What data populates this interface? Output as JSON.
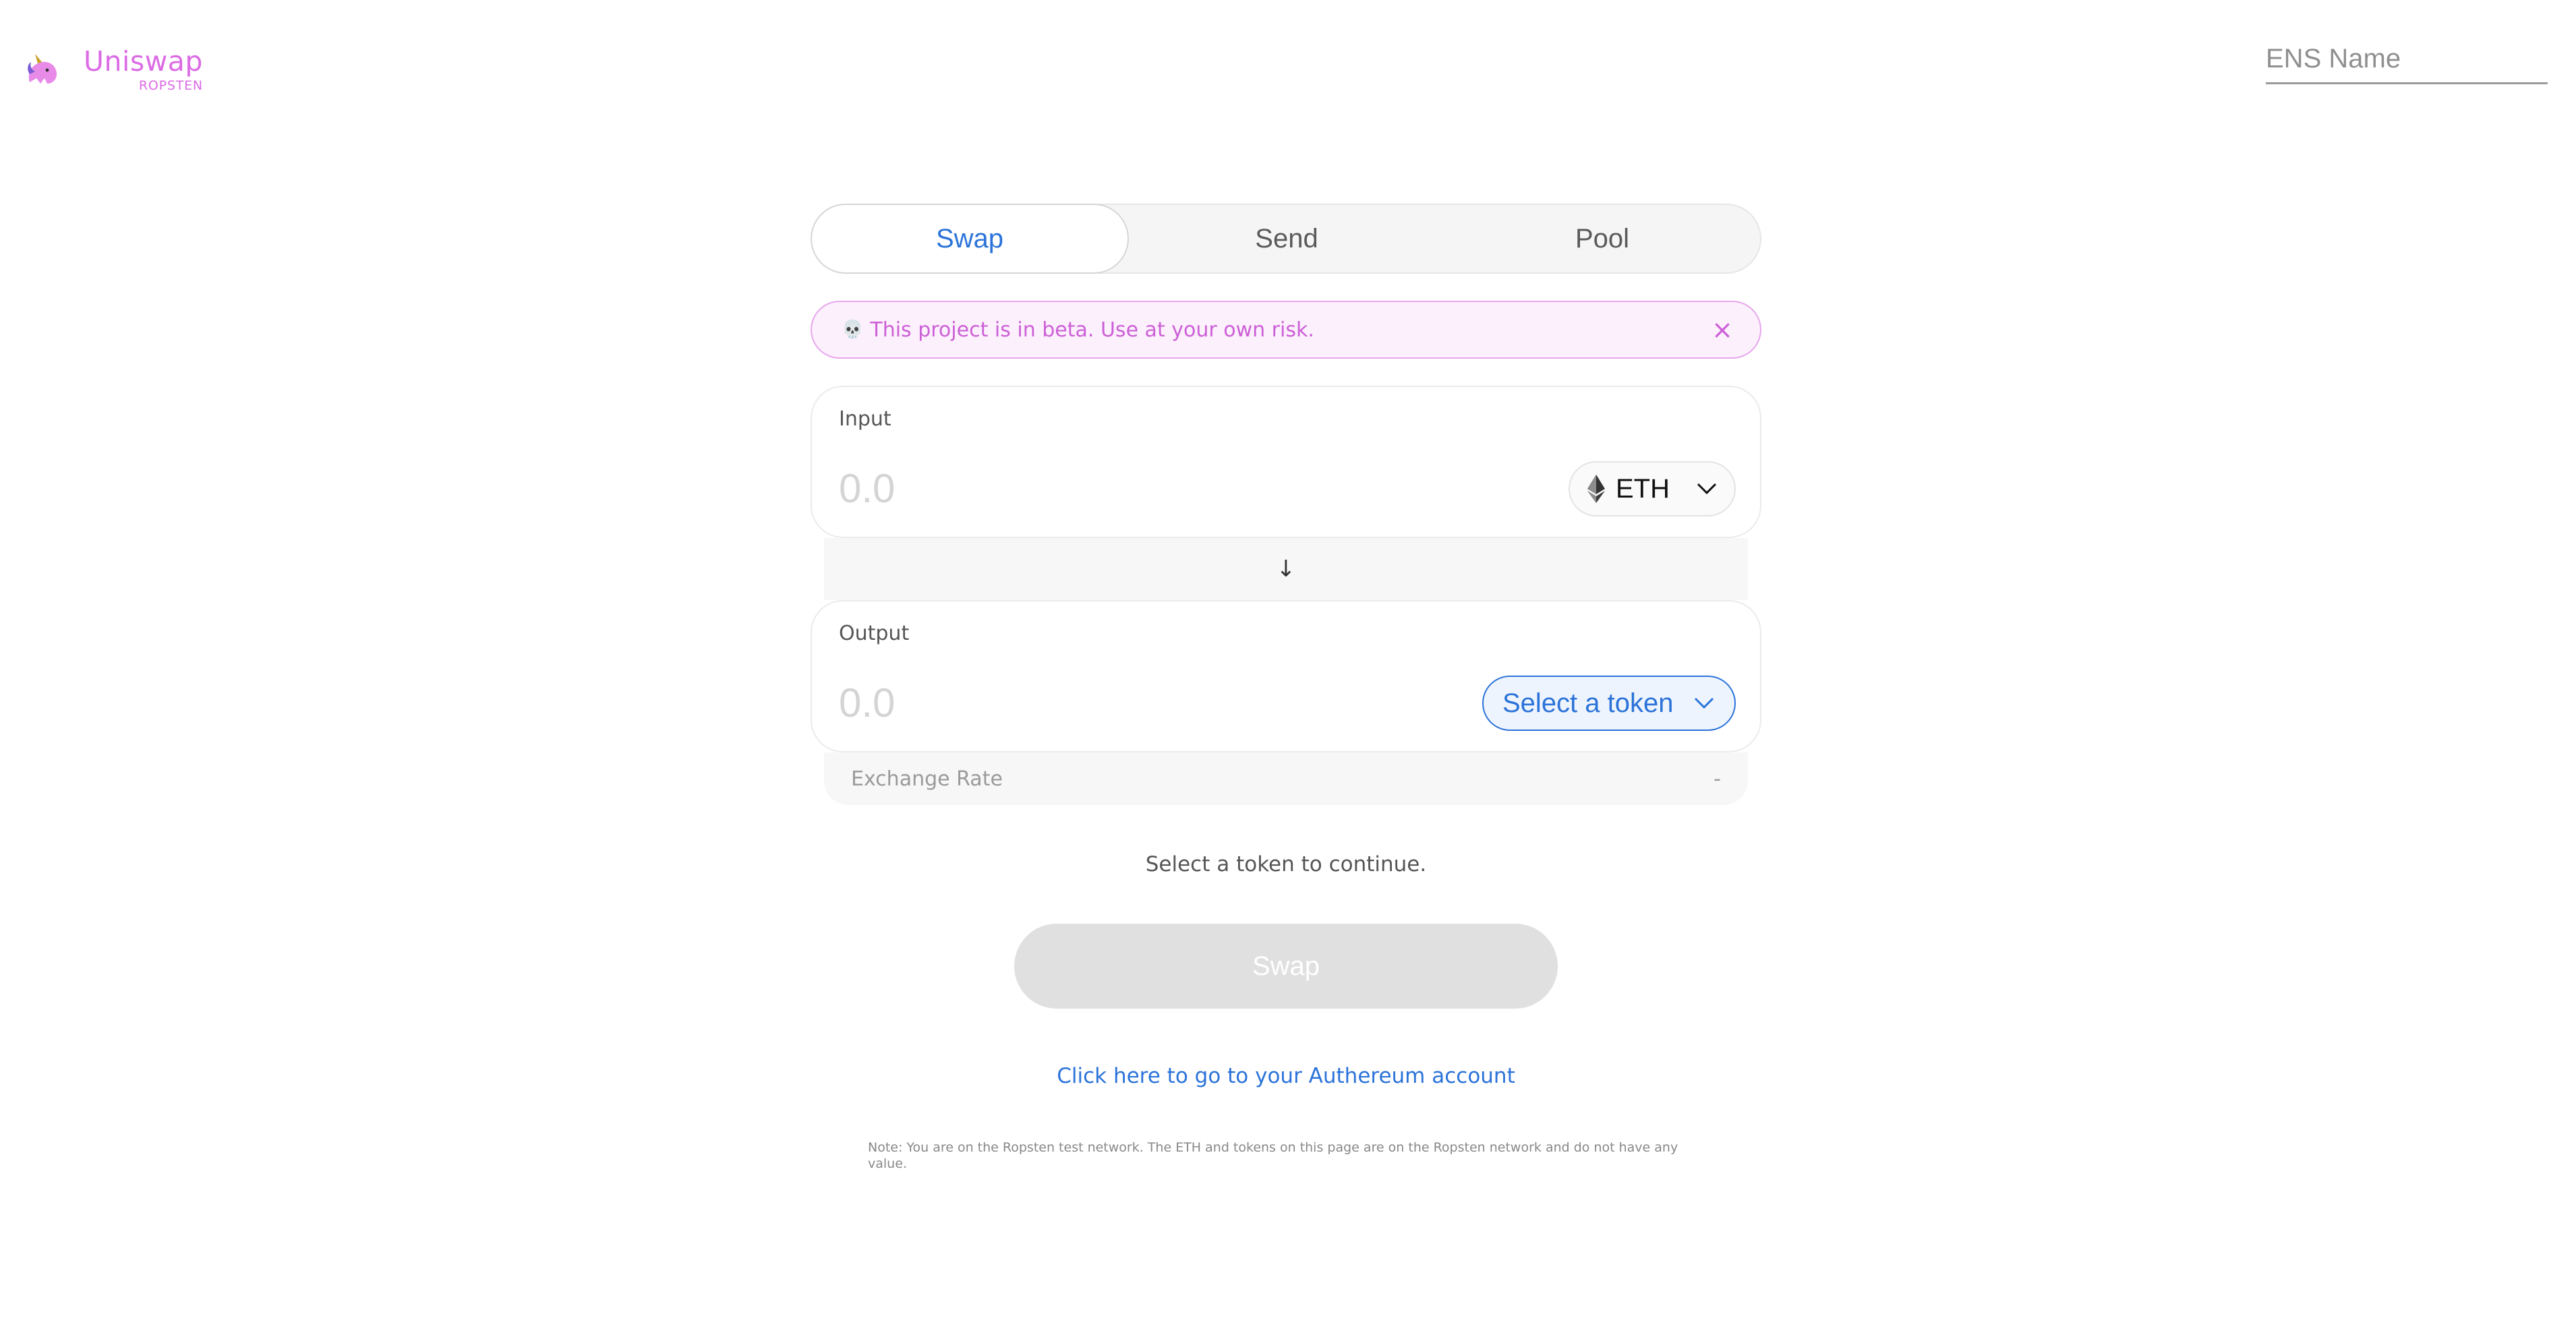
{
  "header": {
    "app_name": "Uniswap",
    "network": "ROPSTEN",
    "ens_placeholder": "ENS Name"
  },
  "tabs": [
    {
      "label": "Swap",
      "active": true
    },
    {
      "label": "Send",
      "active": false
    },
    {
      "label": "Pool",
      "active": false
    }
  ],
  "beta_banner": {
    "icon": "💀",
    "text": "This project is in beta. Use at your own risk.",
    "close": "×"
  },
  "input_panel": {
    "label": "Input",
    "placeholder": "0.0",
    "token": "ETH"
  },
  "swap_direction_arrow": "↓",
  "output_panel": {
    "label": "Output",
    "placeholder": "0.0",
    "token": "Select a token"
  },
  "exchange_rate": {
    "label": "Exchange Rate",
    "value": "-"
  },
  "status_message": "Select a token to continue.",
  "swap_button": "Swap",
  "account_link": "Click here to go to your Authereum account",
  "network_note": "Note: You are on the Ropsten test network. The ETH and tokens on this page are on the Ropsten network and do not have any value.",
  "colors": {
    "brand_pink": "#dc6be5",
    "accent_blue": "#2b73d9",
    "banner_bg": "#fcf0fd",
    "disabled_button": "#e0e0e0"
  }
}
